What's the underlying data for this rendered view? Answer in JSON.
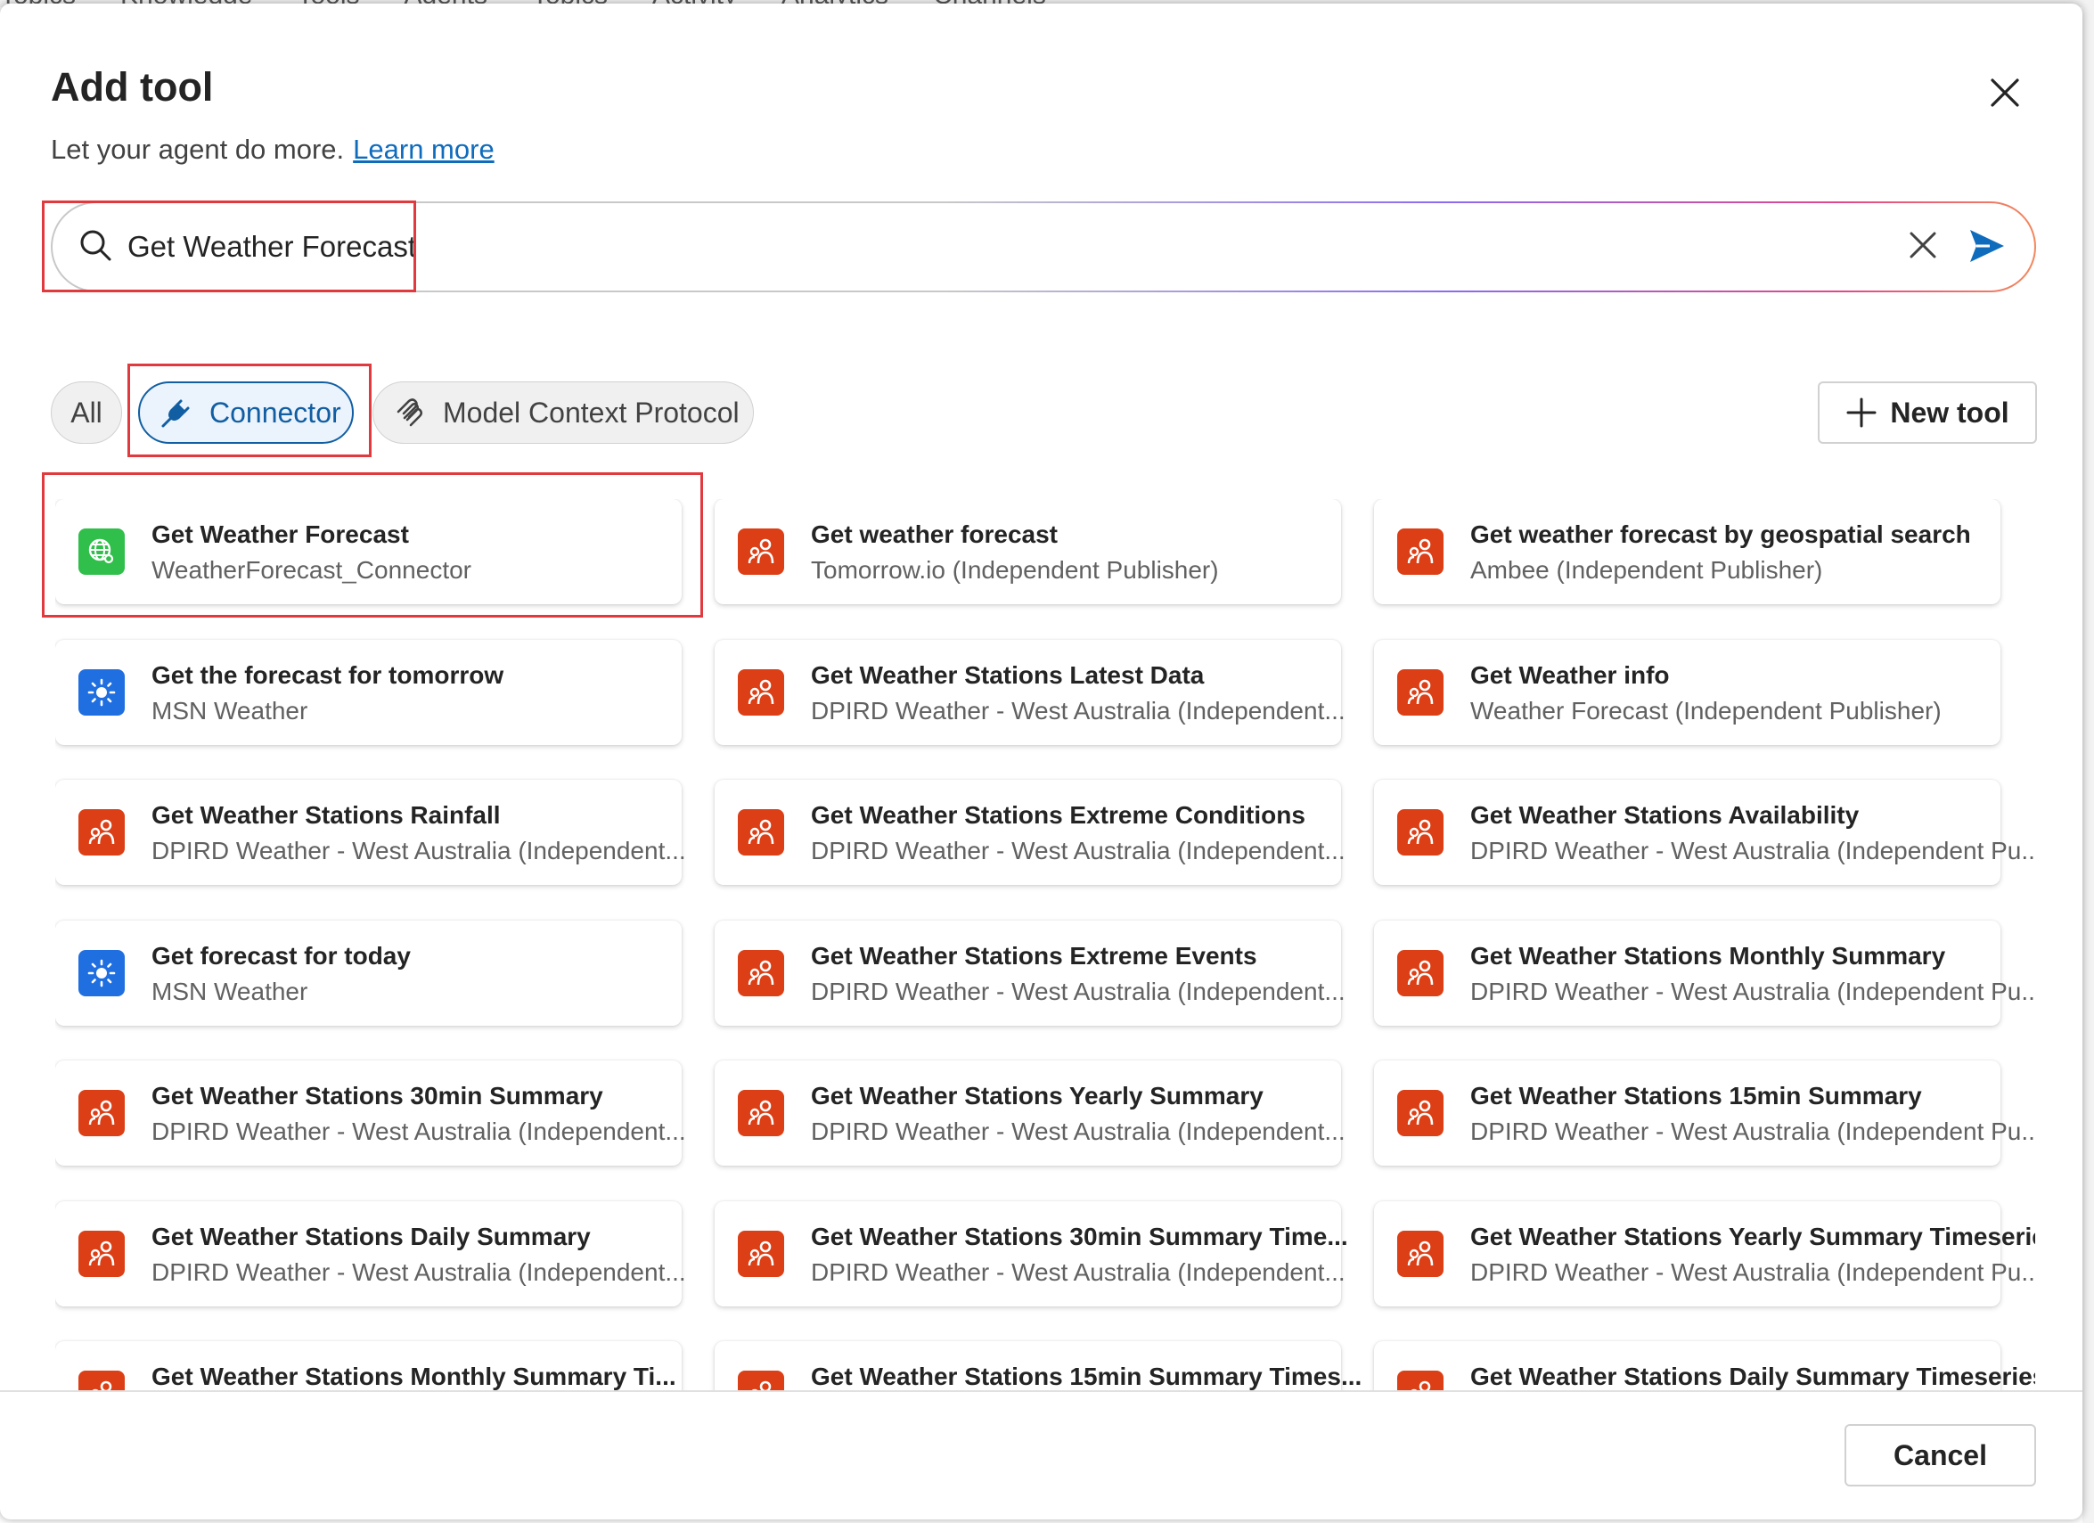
{
  "background_nav": [
    "Topics",
    "Knowledge",
    "Tools",
    "Agents",
    "Topics",
    "Activity",
    "Analytics",
    "Channels"
  ],
  "dialog": {
    "title": "Add tool",
    "subtitle": "Let your agent do more.",
    "learn_more": "Learn more"
  },
  "search": {
    "value": "Get Weather Forecast",
    "placeholder": "Search"
  },
  "filters": {
    "all": "All",
    "connector": "Connector",
    "mcp": "Model Context Protocol",
    "selected": "Connector"
  },
  "new_tool_label": "New tool",
  "cancel_label": "Cancel",
  "colors": {
    "accent": "#115ea3",
    "highlight": "#e03a3e",
    "connector_icon_orange": "#dc3e15",
    "msn_icon_blue": "#1f6fe0",
    "custom_icon_green": "#2fbf4a"
  },
  "tools": [
    {
      "title": "Get Weather Forecast",
      "subtitle": "WeatherForecast_Connector",
      "icon": "globe-icon"
    },
    {
      "title": "Get weather forecast",
      "subtitle": "Tomorrow.io (Independent Publisher)",
      "icon": "connector-icon"
    },
    {
      "title": "Get weather forecast by geospatial search",
      "subtitle": "Ambee (Independent Publisher)",
      "icon": "connector-icon"
    },
    {
      "title": "Get the forecast for tomorrow",
      "subtitle": "MSN Weather",
      "icon": "sun-icon"
    },
    {
      "title": "Get Weather Stations Latest Data",
      "subtitle": "DPIRD Weather - West Australia (Independent...",
      "icon": "connector-icon"
    },
    {
      "title": "Get Weather info",
      "subtitle": "Weather Forecast (Independent Publisher)",
      "icon": "connector-icon"
    },
    {
      "title": "Get Weather Stations Rainfall",
      "subtitle": "DPIRD Weather - West Australia (Independent...",
      "icon": "connector-icon"
    },
    {
      "title": "Get Weather Stations Extreme Conditions",
      "subtitle": "DPIRD Weather - West Australia (Independent...",
      "icon": "connector-icon"
    },
    {
      "title": "Get Weather Stations Availability",
      "subtitle": "DPIRD Weather - West Australia (Independent Pu...",
      "icon": "connector-icon"
    },
    {
      "title": "Get forecast for today",
      "subtitle": "MSN Weather",
      "icon": "sun-icon"
    },
    {
      "title": "Get Weather Stations Extreme Events",
      "subtitle": "DPIRD Weather - West Australia (Independent...",
      "icon": "connector-icon"
    },
    {
      "title": "Get Weather Stations Monthly Summary",
      "subtitle": "DPIRD Weather - West Australia (Independent Pu...",
      "icon": "connector-icon"
    },
    {
      "title": "Get Weather Stations 30min Summary",
      "subtitle": "DPIRD Weather - West Australia (Independent...",
      "icon": "connector-icon"
    },
    {
      "title": "Get Weather Stations Yearly Summary",
      "subtitle": "DPIRD Weather - West Australia (Independent...",
      "icon": "connector-icon"
    },
    {
      "title": "Get Weather Stations 15min Summary",
      "subtitle": "DPIRD Weather - West Australia (Independent Pu...",
      "icon": "connector-icon"
    },
    {
      "title": "Get Weather Stations Daily Summary",
      "subtitle": "DPIRD Weather - West Australia (Independent...",
      "icon": "connector-icon"
    },
    {
      "title": "Get Weather Stations 30min Summary Time...",
      "subtitle": "DPIRD Weather - West Australia (Independent...",
      "icon": "connector-icon"
    },
    {
      "title": "Get Weather Stations Yearly Summary Timeseries",
      "subtitle": "DPIRD Weather - West Australia (Independent Pu...",
      "icon": "connector-icon"
    },
    {
      "title": "Get Weather Stations Monthly Summary Ti...",
      "subtitle": "",
      "icon": "connector-icon"
    },
    {
      "title": "Get Weather Stations 15min Summary Times...",
      "subtitle": "",
      "icon": "connector-icon"
    },
    {
      "title": "Get Weather Stations Daily Summary Timeseries",
      "subtitle": "",
      "icon": "connector-icon"
    }
  ]
}
